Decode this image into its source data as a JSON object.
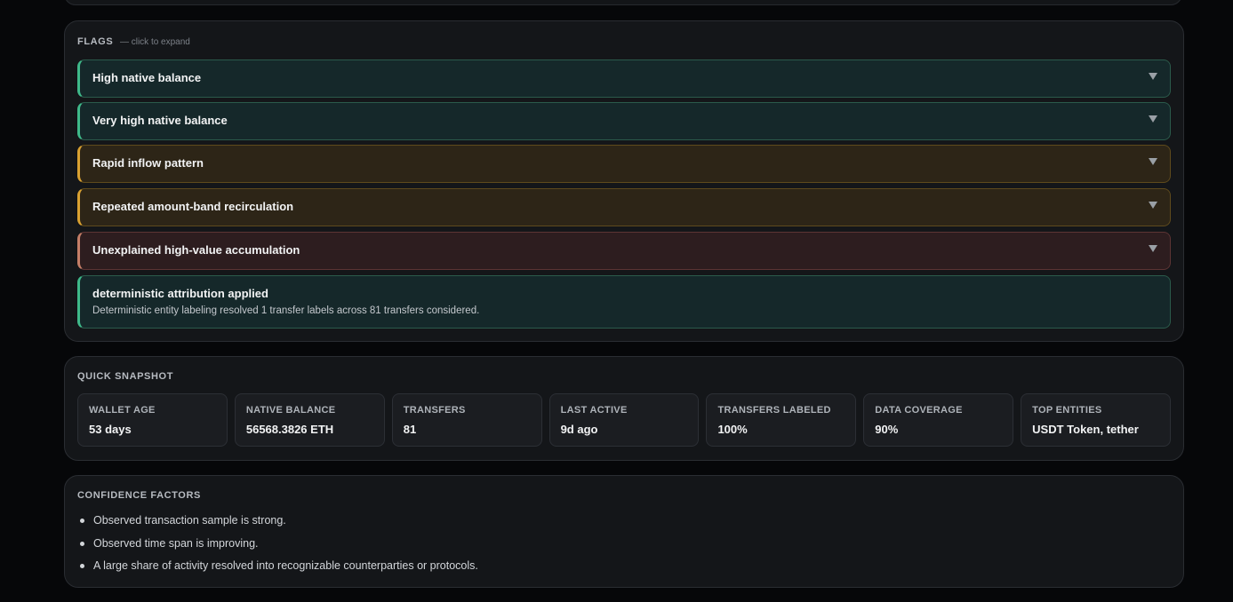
{
  "flags": {
    "title": "FLAGS",
    "hint": "— click to expand",
    "items": [
      {
        "label": "High native balance",
        "level": "green"
      },
      {
        "label": "Very high native balance",
        "level": "green"
      },
      {
        "label": "Rapid inflow pattern",
        "level": "amber"
      },
      {
        "label": "Repeated amount-band recirculation",
        "level": "amber"
      },
      {
        "label": "Unexplained high-value accumulation",
        "level": "red"
      }
    ],
    "info": {
      "title": "deterministic attribution applied",
      "description": "Deterministic entity labeling resolved 1 transfer labels across 81 transfers considered."
    }
  },
  "snapshot": {
    "title": "QUICK SNAPSHOT",
    "stats": [
      {
        "label": "WALLET AGE",
        "value": "53 days"
      },
      {
        "label": "NATIVE BALANCE",
        "value": "56568.3826 ETH"
      },
      {
        "label": "TRANSFERS",
        "value": "81"
      },
      {
        "label": "LAST ACTIVE",
        "value": "9d ago"
      },
      {
        "label": "TRANSFERS LABELED",
        "value": "100%"
      },
      {
        "label": "DATA COVERAGE",
        "value": "90%"
      },
      {
        "label": "TOP ENTITIES",
        "value": "USDT Token, tether"
      }
    ]
  },
  "confidence": {
    "title": "CONFIDENCE FACTORS",
    "factors": [
      "Observed transaction sample is strong.",
      "Observed time span is improving.",
      "A large share of activity resolved into recognizable counterparties or protocols."
    ]
  },
  "colors": {
    "green": "#3fb98a",
    "amber": "#d9a131",
    "red": "#c47e67",
    "background": "#060709",
    "panel": "#141619"
  },
  "icons": {
    "flag_toggle": "chevron-down-icon",
    "list_bullet": "bullet-icon"
  }
}
